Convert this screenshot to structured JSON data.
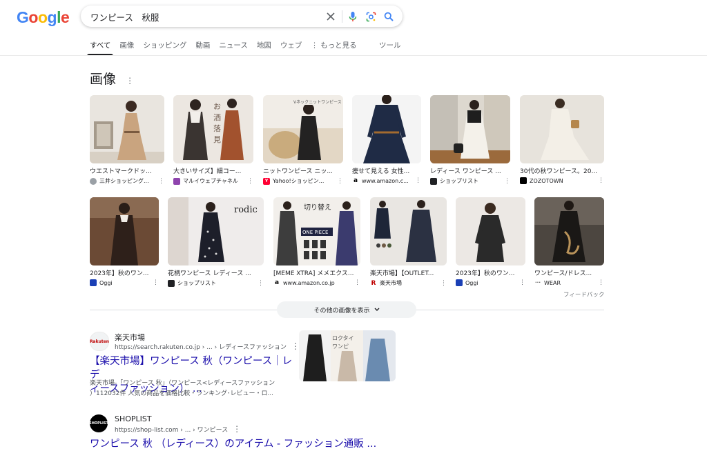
{
  "logo": {
    "letters": [
      "G",
      "o",
      "o",
      "g",
      "l",
      "e"
    ],
    "colors": [
      "#4285F4",
      "#EA4335",
      "#FBBC05",
      "#4285F4",
      "#34A853",
      "#EA4335"
    ]
  },
  "search": {
    "query": "ワンピース　秋服"
  },
  "tabs": [
    {
      "label": "すべて",
      "active": true
    },
    {
      "label": "画像"
    },
    {
      "label": "ショッピング"
    },
    {
      "label": "動画"
    },
    {
      "label": "ニュース"
    },
    {
      "label": "地図"
    },
    {
      "label": "ウェブ"
    },
    {
      "label": "⋮ もっと見る"
    }
  ],
  "tools_label": "ツール",
  "images_section": {
    "title": "画像",
    "row1": [
      {
        "caption": "ウエストマークドッ...",
        "source": "三井ショッピング...",
        "fav_color": "#9aa0a6"
      },
      {
        "caption": "大きいサイズ】細コー...",
        "source": "マルイウェブチャネル",
        "fav_color": "#8e44ad"
      },
      {
        "caption": "ニットワンピース ニッ...",
        "source": "Yahoo!ショッピン...",
        "fav_color": "#ff0033",
        "fav_text": "Y!"
      },
      {
        "caption": "痩せて見える 女性...",
        "source": "www.amazon.c...",
        "fav_color": "#ffffff",
        "fav_text": "a"
      },
      {
        "caption": "レディース ワンピース ...",
        "source": "ショップリスト",
        "fav_color": "#202124"
      },
      {
        "caption": "30代の秋ワンピース。20...",
        "source": "ZOZOTOWN",
        "fav_color": "#000000"
      }
    ],
    "row2": [
      {
        "caption": "2023年】秋のワン...",
        "source": "Oggi",
        "fav_color": "#1a3fb5"
      },
      {
        "caption": "花柄ワンピース レディース ...",
        "source": "ショップリスト",
        "fav_color": "#202124"
      },
      {
        "caption": "[MEME XTRA] メメエクス...",
        "source": "www.amazon.co.jp",
        "fav_color": "#ffffff",
        "fav_text": "a"
      },
      {
        "caption": "楽天市場】【OUTLET...",
        "source": "楽天市場",
        "fav_color": "#ffffff",
        "fav_text": "R"
      },
      {
        "caption": "2023年】秋のワン...",
        "source": "Oggi",
        "fav_color": "#1a3fb5"
      },
      {
        "caption": "ワンピース/ドレス...",
        "source": "WEAR",
        "fav_color": "#ffffff",
        "fav_text": "···"
      }
    ],
    "feedback": "フィードバック",
    "more_images": "その他の画像を表示"
  },
  "results": [
    {
      "site": "楽天市場",
      "url": "https://search.rakuten.co.jp › ... › レディースファッション",
      "title_line1": "【楽天市場】ワンピース 秋（ワンピース｜レデ",
      "title_line2": "ィースファッション） ...",
      "snippet_line1": "楽天市場-「ワンピース 秋」（ワンピース<レディースファッション",
      "snippet_line2": "）112032件 人気の商品を価格比較・ランキング･レビュー・ロ...",
      "logo_text": "Rakuten"
    },
    {
      "site": "SHOPLIST",
      "url": "https://shop-list.com › ... › ワンピース",
      "title_line1": "ワンピース 秋 （レディース）のアイテム - ファッション通販 ...",
      "logo_text": "SHOPLIST"
    }
  ]
}
